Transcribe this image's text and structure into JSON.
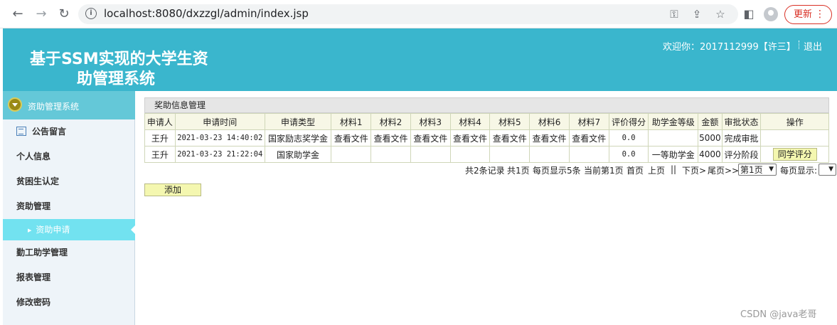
{
  "browser": {
    "url": "localhost:8080/dxzzgl/admin/index.jsp",
    "update_label": "更新"
  },
  "header": {
    "title_line1": "基于SSM实现的大学生资",
    "title_line2": "助管理系统",
    "welcome": "欢迎你：2017112999【许三】",
    "logout": "退出"
  },
  "sidebar": {
    "system": "资助管理系统",
    "items": [
      {
        "label": "公告留言"
      },
      {
        "label": "个人信息"
      },
      {
        "label": "贫困生认定"
      },
      {
        "label": "资助管理"
      },
      {
        "label": "资助申请"
      },
      {
        "label": "勤工助学管理"
      },
      {
        "label": "报表管理"
      },
      {
        "label": "修改密码"
      }
    ]
  },
  "main": {
    "panel_title": "奖助信息管理",
    "columns": [
      "申请人",
      "申请时间",
      "申请类型",
      "材料1",
      "材料2",
      "材料3",
      "材料4",
      "材料5",
      "材料6",
      "材料7",
      "评价得分",
      "助学金等级",
      "金额",
      "审批状态",
      "操作"
    ],
    "rows": [
      {
        "name": "王升",
        "time": "2021-03-23 14:40:02",
        "type": "国家励志奖学金",
        "m1": "查看文件",
        "m2": "查看文件",
        "m3": "查看文件",
        "m4": "查看文件",
        "m5": "查看文件",
        "m6": "查看文件",
        "m7": "查看文件",
        "score": "0.0",
        "level": "",
        "amount": "5000",
        "status": "完成审批",
        "action": ""
      },
      {
        "name": "王升",
        "time": "2021-03-23 21:22:04",
        "type": "国家助学金",
        "m1": "",
        "m2": "",
        "m3": "",
        "m4": "",
        "m5": "",
        "m6": "",
        "m7": "",
        "score": "0.0",
        "level": "一等助学金",
        "amount": "4000",
        "status": "评分阶段",
        "action": "同学评分"
      }
    ],
    "pager": {
      "total": "共2条记录",
      "pages": "共1页",
      "per_page": "每页显示5条",
      "current": "当前第1页",
      "first": "首页",
      "prev": "上页",
      "divider": "||",
      "next": "下页>",
      "last": "尾页>>",
      "page_select": "第1页",
      "per_page_label": "每页显示:",
      "per_page_select": ""
    },
    "add_label": "添加"
  },
  "watermark": "CSDN @java老哥"
}
